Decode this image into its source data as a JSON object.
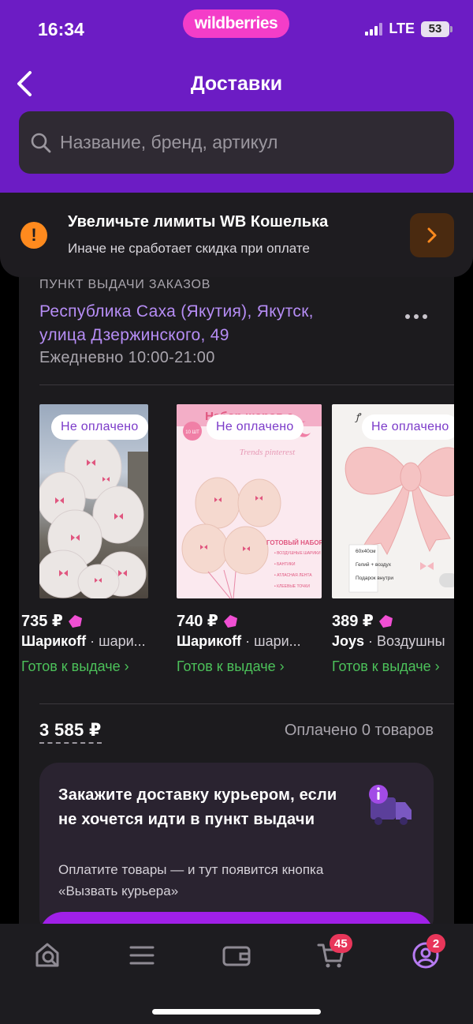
{
  "status_bar": {
    "time": "16:34",
    "network": "LTE",
    "battery": "53"
  },
  "brand": {
    "logo_text": "wildberries"
  },
  "header": {
    "title": "Доставки"
  },
  "search": {
    "placeholder": "Название, бренд, артикул"
  },
  "wallet_banner": {
    "title": "Увеличьте лимиты WB Кошелька",
    "subtitle": "Иначе не сработает скидка при оплате"
  },
  "pickup": {
    "label": "ПУНКТ ВЫДАЧИ ЗАКАЗОВ",
    "address_line1": "Республика Саха (Якутия), Якутск,",
    "address_line2": "улица Дзержинского, 49",
    "hours": "Ежедневно 10:00-21:00"
  },
  "products": [
    {
      "badge": "Не оплачено",
      "price": "735 ₽",
      "brand": "Шарикoff",
      "name": " · шари...",
      "status": "Готов к выдаче ›"
    },
    {
      "badge": "Не оплачено",
      "price": "740 ₽",
      "brand": "Шарикoff",
      "name": " · шари...",
      "status": "Готов к выдаче ›"
    },
    {
      "badge": "Не оплачено",
      "price": "389 ₽",
      "brand": "Joys",
      "name": " · Воздушны",
      "status": "Готов к выдаче ›"
    }
  ],
  "product_image_text": {
    "p2_heading": "Набор шаров с",
    "p2_sub": "Trends pinterest",
    "p2_count": "10 ШТ",
    "p2_set": "ГОТОВЫЙ НАБОР",
    "p2_list": [
      "• ВОЗДУШНЫЕ ШАРИКИ",
      "• БАНТИКИ",
      "• АТЛАСНАЯ ЛЕНТА",
      "• КЛЕЕВЫЕ ТОЧКИ"
    ],
    "p3_size": "60x40см",
    "p3_gas": "Гелий + воздух",
    "p3_gift": "Подарок внутри"
  },
  "summary": {
    "total": "3 585 ₽",
    "paid": "Оплачено 0 товаров"
  },
  "courier": {
    "title": "Закажите доставку курьером, если не хочется идти в пункт выдачи",
    "subtitle": "Оплатите товары — и тут появится кнопка «Вызвать курьера»"
  },
  "tabbar": {
    "cart_badge": "45",
    "profile_badge": "2"
  },
  "colors": {
    "header_bg": "#6c1cc4",
    "logo_bg": "#f43dc8",
    "address": "#b68df5",
    "ready_status": "#4cc15a",
    "badge_text": "#7b3ac9",
    "warning": "#ff8a1e",
    "notification": "#e8365a"
  },
  "icons": [
    "back-arrow-icon",
    "search-icon",
    "warning-icon",
    "chevron-right-icon",
    "more-dots-icon",
    "diamond-icon",
    "truck-icon",
    "info-icon",
    "home-search-icon",
    "menu-icon",
    "wallet-icon",
    "cart-icon",
    "profile-icon"
  ]
}
